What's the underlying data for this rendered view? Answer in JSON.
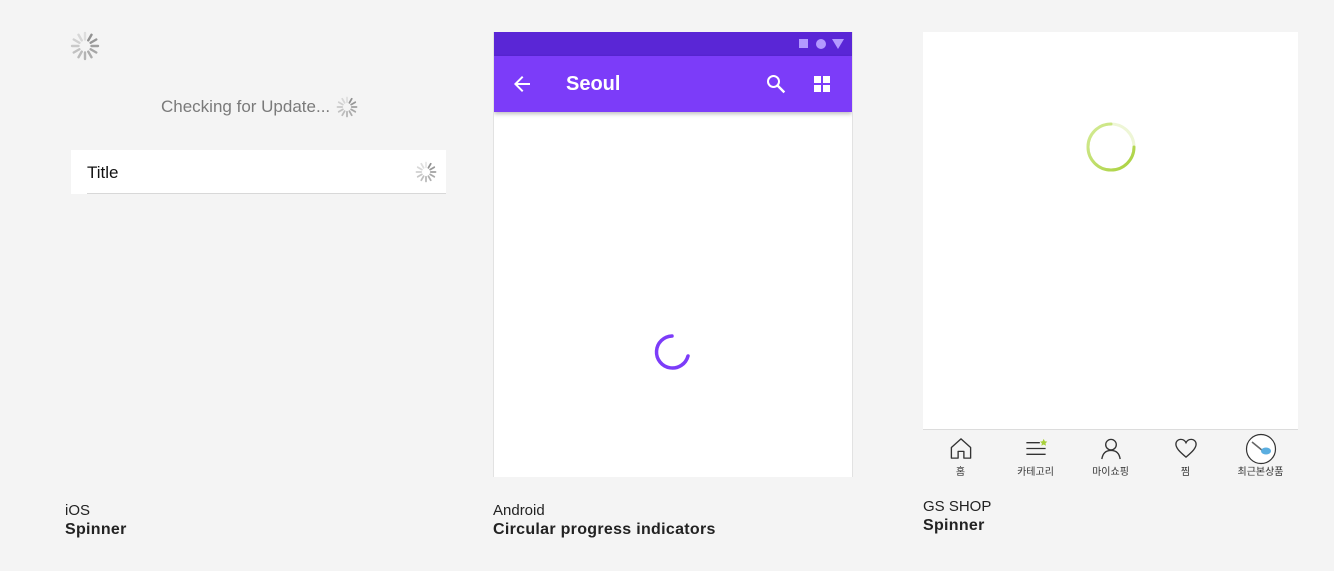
{
  "ios": {
    "checking_text": "Checking for Update...",
    "row_title": "Title",
    "caption_platform": "iOS",
    "caption_name": "Spinner"
  },
  "android": {
    "appbar_title": "Seoul",
    "caption_platform": "Android",
    "caption_name": "Circular progress indicators",
    "colors": {
      "status_bar": "#5a26d6",
      "app_bar": "#7c3cf9",
      "progress": "#7c3cf9"
    },
    "icons": [
      "square-icon",
      "circle-icon",
      "triangle-icon",
      "arrow-back-icon",
      "search-icon",
      "grid-icon"
    ]
  },
  "gsshop": {
    "caption_platform": "GS SHOP",
    "caption_name": "Spinner",
    "colors": {
      "spinner": "#b8d94a"
    },
    "tabs": [
      {
        "label": "홈",
        "icon": "home-icon"
      },
      {
        "label": "카테고리",
        "icon": "category-icon"
      },
      {
        "label": "마이쇼핑",
        "icon": "person-icon"
      },
      {
        "label": "찜",
        "icon": "heart-icon"
      },
      {
        "label": "최근본상품",
        "icon": "recent-item-icon"
      }
    ]
  }
}
